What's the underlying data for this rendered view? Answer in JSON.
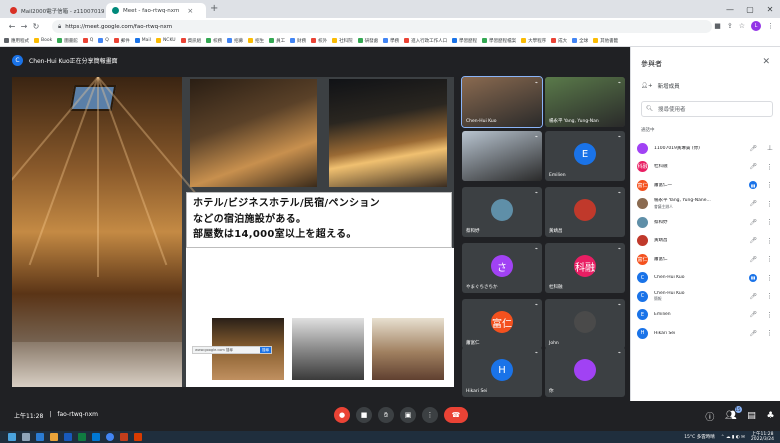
{
  "browser": {
    "tabs": [
      {
        "title": "Mail2000電子信箱 - z11007019",
        "favicon_color": "#d93025"
      },
      {
        "title": "Meet - fao-rtwq-nxm",
        "favicon_color": "#00897b"
      }
    ],
    "new_tab": "+",
    "window_controls": [
      "—",
      "▢",
      "✕"
    ],
    "url": "https://meet.google.com/fao-rtwq-nxm",
    "profile_initial": "L",
    "bookmarks": [
      "應用程式",
      "Book",
      "圖書館",
      "Q",
      "Q",
      "郵件",
      "Mail",
      "NCKU",
      "資訊組",
      "校務",
      "招募",
      "招生",
      "員工",
      "財務",
      "校外",
      "社科院",
      "研發處",
      "學務",
      "進入行政工作人口",
      "學習歷程",
      "學習歷程檔案",
      "大學程序",
      "成大",
      "全球",
      "其他書籤"
    ]
  },
  "meet": {
    "presenter_banner": "Chen-Hui Kuo正在分享簡報畫面",
    "presenter_initial": "C",
    "slide": {
      "lines": [
        "ホテル/ビジネスホテル/民宿/ペンション",
        "などの宿泊施設がある。",
        "部屋数は14,000室以上を超える。"
      ],
      "search_strip_text": "www.google.com 搜尋",
      "search_strip_button": "搜尋"
    },
    "tiles": [
      {
        "name": "Chen-Hui Kuo",
        "type": "camera",
        "active": true,
        "color": "#8a6a50"
      },
      {
        "name": "楊永平 Yang, Yung-Nan",
        "type": "camera",
        "active": false,
        "color": "#5a7a4a"
      },
      {
        "name": "",
        "type": "camera",
        "active": false,
        "color": "#b8c4d0"
      },
      {
        "name": "Emilien",
        "type": "avatar",
        "initial": "E",
        "color": "#1a73e8"
      },
      {
        "name": "蔡和妤",
        "type": "avatar",
        "initial": "",
        "color": "#5f8fa8"
      },
      {
        "name": "黃靖昌",
        "type": "avatar",
        "initial": "",
        "color": "#c0392b"
      },
      {
        "name": "やまぐちさちか",
        "type": "avatar",
        "initial": "さ",
        "color": "#a142f4"
      },
      {
        "name": "杜科融",
        "type": "avatar",
        "initial": "科融",
        "color": "#e91e63"
      },
      {
        "name": "蕭富仁",
        "type": "avatar",
        "initial": "富仁",
        "color": "#f4511e"
      },
      {
        "name": "John",
        "type": "avatar",
        "initial": "",
        "color": "#4a4a4a"
      },
      {
        "name": "Hikari Sei",
        "type": "avatar",
        "initial": "H",
        "color": "#1a73e8"
      },
      {
        "name": "你",
        "type": "avatar",
        "initial": "",
        "color": "#a142f4"
      }
    ],
    "bottom": {
      "time": "上午11:28",
      "separator": "|",
      "meeting_code": "fao-rtwq-nxm",
      "participant_count": "15"
    }
  },
  "participants": {
    "title": "參與者",
    "close": "✕",
    "add_people": "新增成員",
    "search_placeholder": "搜尋使用者",
    "in_call_label": "通話中",
    "list": [
      {
        "name": "11007019黃琳貴 (你)",
        "sub": "",
        "initial": "",
        "color": "#a142f4",
        "status": "mic-off",
        "extra": "pin"
      },
      {
        "name": "杜科融",
        "sub": "",
        "initial": "科融",
        "color": "#e91e63",
        "status": "mic-off",
        "extra": "more"
      },
      {
        "name": "蕭富仁一",
        "sub": "",
        "initial": "富仁",
        "color": "#f4511e",
        "status": "speaking",
        "extra": "more"
      },
      {
        "name": "楊永平 Yang, Yung-Nane...",
        "sub": "會議主辦人",
        "initial": "",
        "color": "#8a6a50",
        "status": "mic-off",
        "extra": "more"
      },
      {
        "name": "蔡和妤",
        "sub": "",
        "initial": "",
        "color": "#5f8fa8",
        "status": "mic-off",
        "extra": "more"
      },
      {
        "name": "黃靖昌",
        "sub": "",
        "initial": "",
        "color": "#c0392b",
        "status": "mic-off",
        "extra": "more"
      },
      {
        "name": "蕭富仁",
        "sub": "",
        "initial": "富仁",
        "color": "#f4511e",
        "status": "mic-off",
        "extra": "more"
      },
      {
        "name": "Chen-Hui Kuo",
        "sub": "",
        "initial": "C",
        "color": "#1a73e8",
        "status": "speaking",
        "extra": "more"
      },
      {
        "name": "Chen-Hui Kuo",
        "sub": "簡報",
        "initial": "C",
        "color": "#1a73e8",
        "status": "mic-off",
        "extra": "more"
      },
      {
        "name": "Emilien",
        "sub": "",
        "initial": "E",
        "color": "#1a73e8",
        "status": "mic-off",
        "extra": "more"
      },
      {
        "name": "Hikari Sei",
        "sub": "",
        "initial": "H",
        "color": "#1a73e8",
        "status": "mic-off",
        "extra": "more"
      }
    ]
  },
  "taskbar": {
    "weather": "15°C 多雲時晴",
    "clock_time": "上午11:28",
    "clock_date": "2022/3/24"
  }
}
